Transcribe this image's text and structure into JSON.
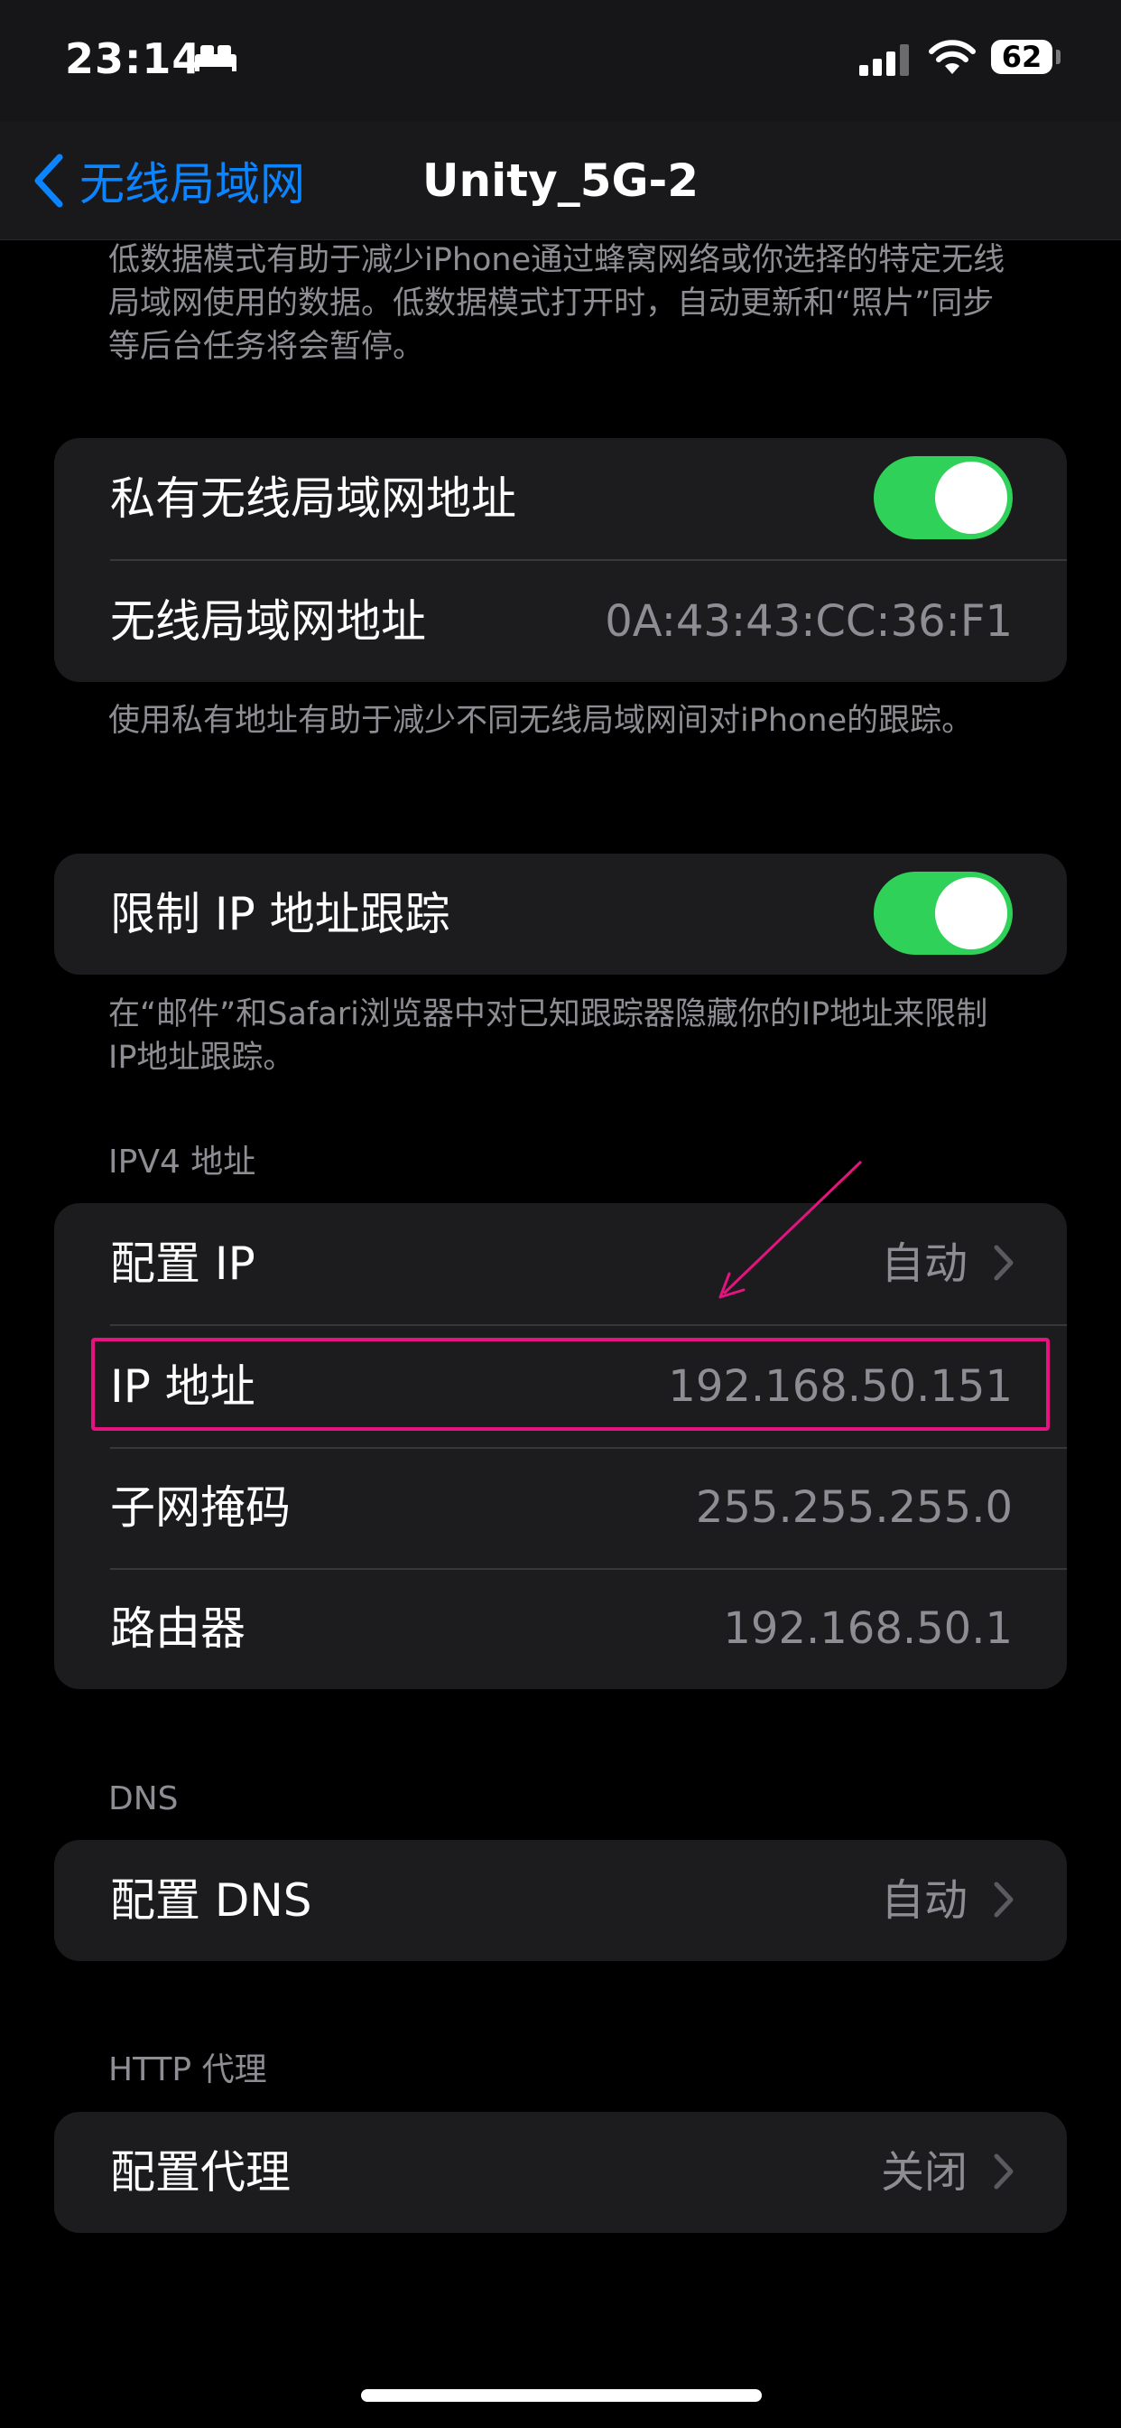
{
  "status_bar": {
    "time": "23:14",
    "battery": "62"
  },
  "nav": {
    "back_label": "无线局域网",
    "title": "Unity_5G-2"
  },
  "top_footer": "低数据模式有助于减少iPhone通过蜂窝网络或你选择的特定无线局域网使用的数据。低数据模式打开时，自动更新和“照片”同步等后台任务将会暂停。",
  "private_group": {
    "private_address_label": "私有无线局域网地址",
    "private_address_on": true,
    "wifi_address_label": "无线局域网地址",
    "wifi_address_value": "0A:43:43:CC:36:F1",
    "footer": "使用私有地址有助于减少不同无线局域网间对iPhone的跟踪。"
  },
  "tracking_group": {
    "limit_tracking_label": "限制 IP 地址跟踪",
    "limit_tracking_on": true,
    "footer": "在“邮件”和Safari浏览器中对已知跟踪器隐藏你的IP地址来限制IP地址跟踪。"
  },
  "ipv4": {
    "header": "IPV4 地址",
    "configure_ip_label": "配置 IP",
    "configure_ip_value": "自动",
    "ip_address_label": "IP 地址",
    "ip_address_value": "192.168.50.151",
    "subnet_mask_label": "子网掩码",
    "subnet_mask_value": "255.255.255.0",
    "router_label": "路由器",
    "router_value": "192.168.50.1"
  },
  "dns": {
    "header": "DNS",
    "configure_dns_label": "配置 DNS",
    "configure_dns_value": "自动"
  },
  "http_proxy": {
    "header": "HTTP 代理",
    "configure_proxy_label": "配置代理",
    "configure_proxy_value": "关闭"
  },
  "colors": {
    "accent": "#0a84ff",
    "toggle_on": "#30d158",
    "annotation": "#e5137f"
  },
  "icons": [
    "sleep-icon",
    "signal-icon",
    "wifi-icon",
    "battery-icon",
    "chevron-left-icon",
    "chevron-right-icon",
    "annotation-arrow"
  ]
}
